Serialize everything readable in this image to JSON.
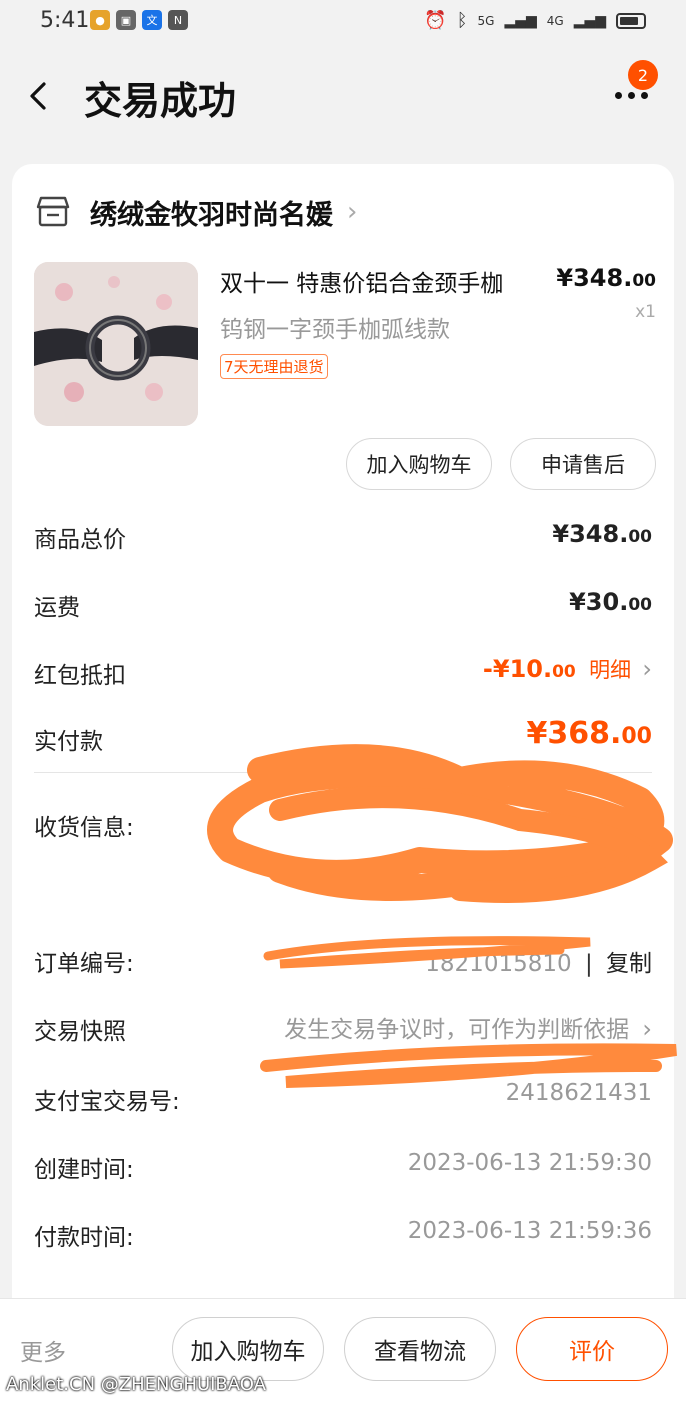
{
  "status_bar": {
    "time": "5:41",
    "signal_1": "5G",
    "signal_2": "4G"
  },
  "header": {
    "title": "交易成功",
    "badge_count": "2"
  },
  "shop": {
    "name": "绣绒金牧羽时尚名媛"
  },
  "product": {
    "title": "双十一 特惠价铝合金颈手枷",
    "spec": "钨钢一字颈手枷弧线款",
    "tag": "7天无理由退货",
    "price_main": "¥348.",
    "price_cents": "00",
    "quantity": "x1",
    "add_cart_label": "加入购物车",
    "after_sale_label": "申请售后"
  },
  "summary": {
    "goods_total_label": "商品总价",
    "goods_total_main": "¥348.",
    "goods_total_cents": "00",
    "shipping_label": "运费",
    "shipping_main": "¥30.",
    "shipping_cents": "00",
    "redpacket_label": "红包抵扣",
    "redpacket_main": "-¥10.",
    "redpacket_cents": "00",
    "redpacket_detail": "明细",
    "paid_label": "实付款",
    "paid_main": "¥368.",
    "paid_cents": "00"
  },
  "info": {
    "shipping_info_label": "收货信息:",
    "order_no_label": "订单编号:",
    "order_no_visible": "1821015810",
    "copy_label": "复制",
    "snapshot_label": "交易快照",
    "snapshot_value": "发生交易争议时，可作为判断依据",
    "alipay_no_label": "支付宝交易号:",
    "alipay_no_visible": "2418621431",
    "created_label": "创建时间:",
    "created_value": "2023-06-13 21:59:30",
    "paid_time_label": "付款时间:",
    "paid_time_value": "2023-06-13 21:59:36"
  },
  "bottom_bar": {
    "more": "更多",
    "add_cart": "加入购物车",
    "logistics": "查看物流",
    "review": "评价"
  },
  "watermark": "Anklet.CN @ZHENGHUIBAOA",
  "colors": {
    "accent": "#ff5000",
    "redaction": "#ff8a3d"
  }
}
